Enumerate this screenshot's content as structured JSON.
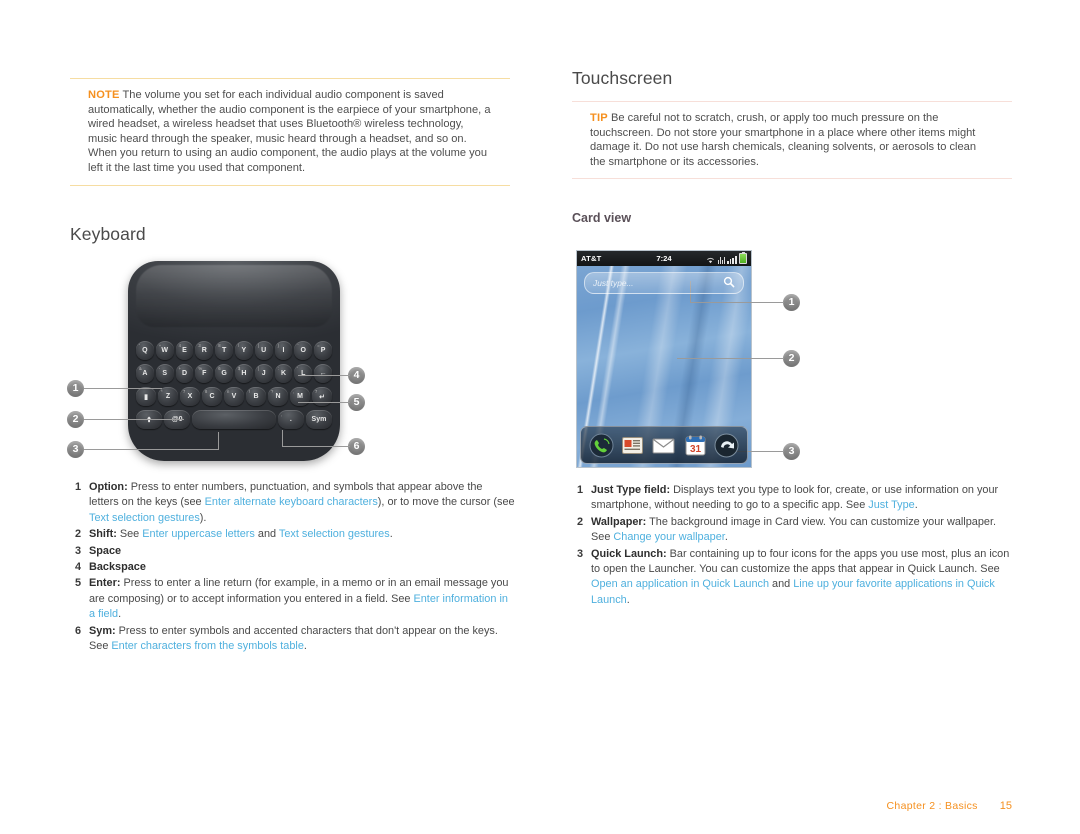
{
  "left_column": {
    "note": {
      "label": "NOTE",
      "text": "The volume you set for each individual audio component is saved automatically, whether the audio component is the earpiece of your smartphone, a wired headset, a wireless headset that uses Bluetooth® wireless technology, music heard through the speaker, music heard through a headset, and so on. When you return to using an audio component, the audio plays at the volume you left it the last time you used that component."
    },
    "heading": "Keyboard",
    "callouts": [
      "1",
      "2",
      "3",
      "4",
      "5",
      "6"
    ],
    "list": [
      {
        "num": "1",
        "term": "Option:",
        "parts": [
          {
            "t": "text",
            "v": " Press to enter numbers, punctuation, and symbols that appear above the letters on the keys (see "
          },
          {
            "t": "link",
            "v": "Enter alternate keyboard characters"
          },
          {
            "t": "text",
            "v": "), or to move the cursor (see "
          },
          {
            "t": "link",
            "v": "Text selection gestures"
          },
          {
            "t": "text",
            "v": ")."
          }
        ]
      },
      {
        "num": "2",
        "term": "Shift:",
        "parts": [
          {
            "t": "text",
            "v": " See "
          },
          {
            "t": "link",
            "v": "Enter uppercase letters"
          },
          {
            "t": "text",
            "v": " and "
          },
          {
            "t": "link",
            "v": "Text selection gestures"
          },
          {
            "t": "text",
            "v": "."
          }
        ]
      },
      {
        "num": "3",
        "term": "Space",
        "parts": []
      },
      {
        "num": "4",
        "term": "Backspace",
        "parts": []
      },
      {
        "num": "5",
        "term": "Enter:",
        "parts": [
          {
            "t": "text",
            "v": " Press to enter a line return (for example, in a memo or in an email message you are composing) or to accept information you entered in a field. See "
          },
          {
            "t": "link",
            "v": "Enter information in a field"
          },
          {
            "t": "text",
            "v": "."
          }
        ]
      },
      {
        "num": "6",
        "term": "Sym:",
        "parts": [
          {
            "t": "text",
            "v": " Press to enter symbols and accented characters that don't appear on the keys. See "
          },
          {
            "t": "link",
            "v": "Enter characters from the symbols table"
          },
          {
            "t": "text",
            "v": "."
          }
        ]
      }
    ],
    "keyboard": {
      "row1": [
        {
          "label": "Q",
          "sup": "'"
        },
        {
          "label": "W",
          "sup": "+"
        },
        {
          "label": "E",
          "sup": "4"
        },
        {
          "label": "R",
          "sup": "3"
        },
        {
          "label": "T",
          "sup": "8"
        },
        {
          "label": "Y",
          "sup": "/"
        },
        {
          "label": "U",
          "sup": "("
        },
        {
          "label": "I",
          "sup": ")"
        },
        {
          "label": "O",
          "sup": "¨"
        },
        {
          "label": "P",
          "sup": "="
        }
      ],
      "row2": [
        {
          "label": "A",
          "sup": "&"
        },
        {
          "label": "S",
          "sup": "-"
        },
        {
          "label": "D",
          "sup": "+"
        },
        {
          "label": "F",
          "sup": "%"
        },
        {
          "label": "G",
          "sup": "6"
        },
        {
          "label": "H",
          "sup": "$"
        },
        {
          "label": "J",
          "sup": "|"
        },
        {
          "label": "K",
          "sup": ":"
        },
        {
          "label": "L",
          "sup": "'"
        },
        {
          "label": "←",
          "sup": ""
        }
      ],
      "row3": [
        {
          "label": "▮",
          "sup": ""
        },
        {
          "label": "Z",
          "sup": "*"
        },
        {
          "label": "X",
          "sup": "7"
        },
        {
          "label": "C",
          "sup": "8"
        },
        {
          "label": "V",
          "sup": "n"
        },
        {
          "label": "B",
          "sup": "!"
        },
        {
          "label": "N",
          "sup": "?"
        },
        {
          "label": "M",
          "sup": ","
        },
        {
          "label": "↵",
          "sup": "7"
        }
      ],
      "row4": [
        {
          "label": "⬆",
          "sup": ""
        },
        {
          "label": "@0",
          "sup": ""
        },
        {
          "label": "",
          "sup": ""
        },
        {
          "label": ".",
          "sup": ","
        },
        {
          "label": "Sym",
          "sup": ""
        }
      ]
    }
  },
  "right_column": {
    "heading": "Touchscreen",
    "tip": {
      "label": "TIP",
      "text": "Be careful not to scratch, crush, or apply too much pressure on the touchscreen. Do not store your smartphone in a place where other items might damage it. Do not use harsh chemicals, cleaning solvents, or aerosols to clean the smartphone or its accessories."
    },
    "subheading": "Card view",
    "callouts": [
      "1",
      "2",
      "3"
    ],
    "phone": {
      "status": {
        "carrier": "AT&T",
        "time": "7:24",
        "icons": [
          "wifi-icon",
          "bluetooth-icon",
          "signal-icon",
          "battery-icon"
        ]
      },
      "search_placeholder": "Just type...",
      "search_icon": "magnifier-icon",
      "quick_launch": [
        "phone-icon",
        "contacts-icon",
        "email-icon",
        "calendar-icon",
        "launcher-icon"
      ],
      "calendar_day": "31"
    },
    "list": [
      {
        "num": "1",
        "term": "Just Type field:",
        "parts": [
          {
            "t": "text",
            "v": " Displays text you type to look for, create, or use information on your smartphone, without needing to go to a specific app. See "
          },
          {
            "t": "link",
            "v": "Just Type"
          },
          {
            "t": "text",
            "v": "."
          }
        ]
      },
      {
        "num": "2",
        "term": "Wallpaper:",
        "parts": [
          {
            "t": "text",
            "v": " The background image in Card view. You can customize your wallpaper. See "
          },
          {
            "t": "link",
            "v": "Change your wallpaper"
          },
          {
            "t": "text",
            "v": "."
          }
        ]
      },
      {
        "num": "3",
        "term": "Quick Launch:",
        "parts": [
          {
            "t": "text",
            "v": " Bar containing up to four icons for the apps you use most, plus an icon to open the Launcher. You can customize the apps that appear in Quick Launch. See "
          },
          {
            "t": "link",
            "v": "Open an application in Quick Launch"
          },
          {
            "t": "text",
            "v": " and "
          },
          {
            "t": "link",
            "v": "Line up your favorite applications in Quick Launch"
          },
          {
            "t": "text",
            "v": "."
          }
        ]
      }
    ]
  },
  "footer": {
    "chapter": "Chapter 2 :  Basics",
    "page": "15"
  },
  "colors": {
    "accent_orange": "#f5901f",
    "link_blue": "#4fb0de",
    "rule_yellow": "#f6dda2",
    "rule_pink": "#f7dfd9",
    "badge_gray": "#8b8b8b"
  }
}
